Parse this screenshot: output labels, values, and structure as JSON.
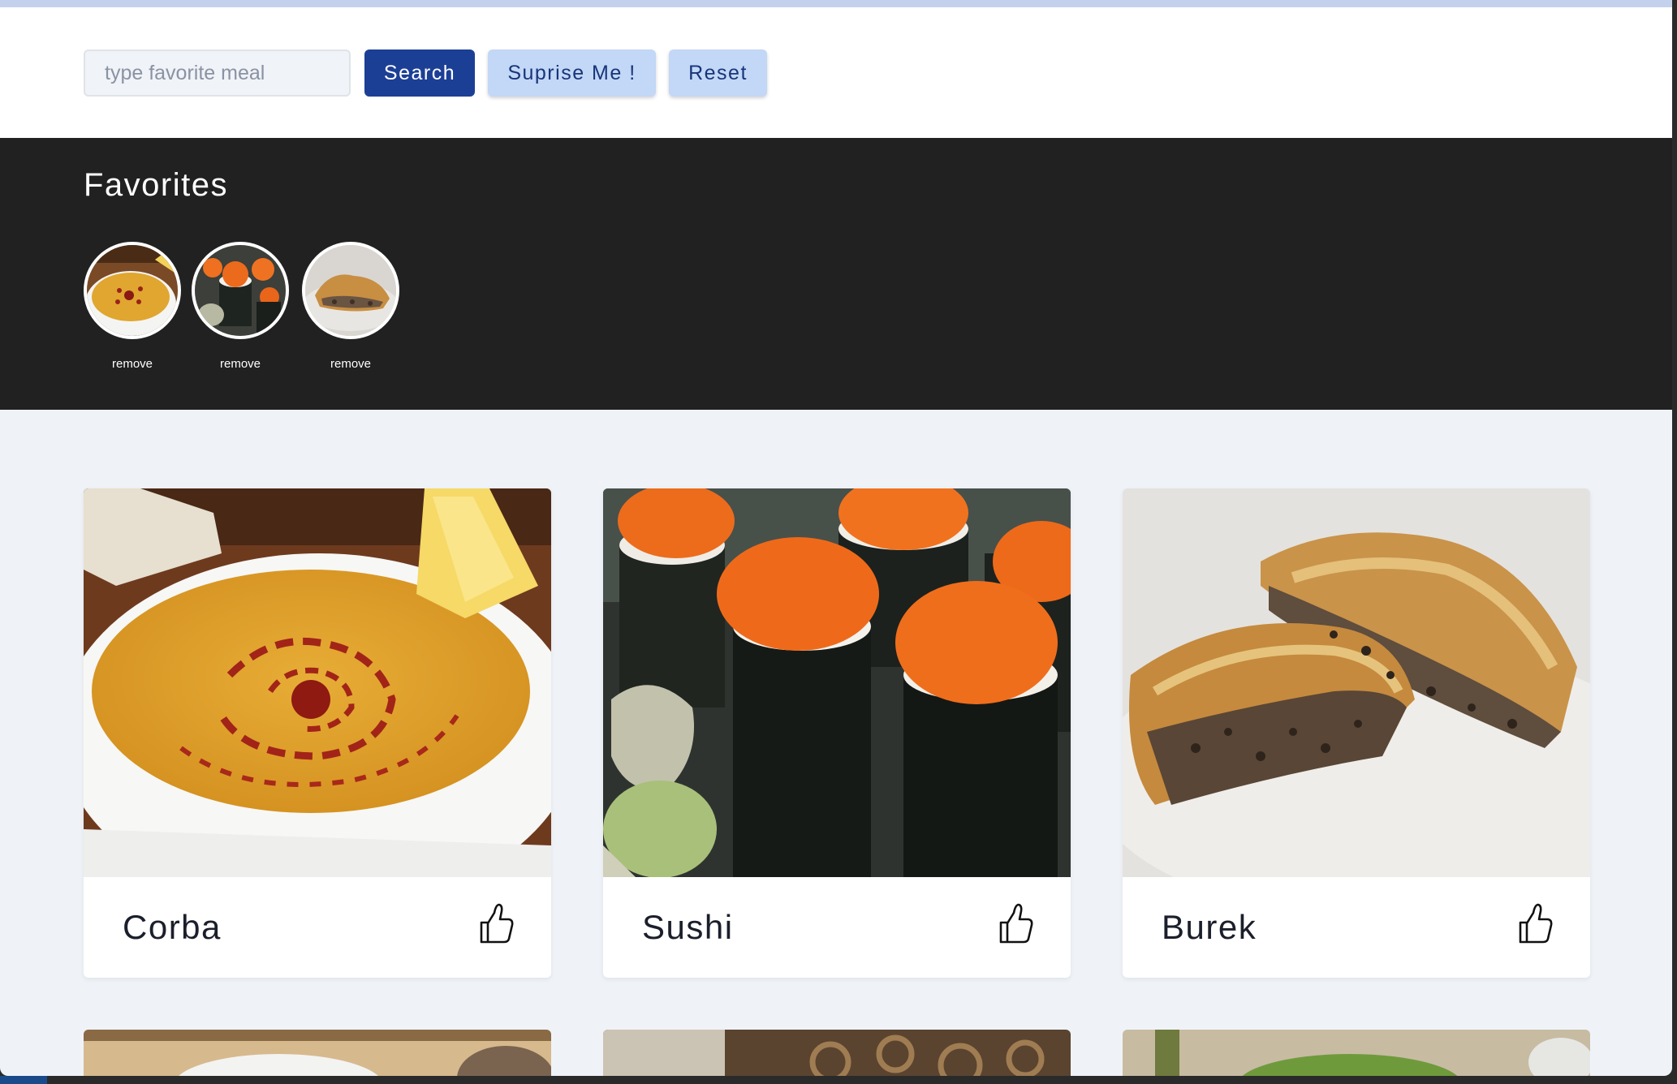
{
  "search": {
    "placeholder": "type favorite meal",
    "value": ""
  },
  "buttons": {
    "search_label": "Search",
    "surprise_label": "Suprise Me !",
    "reset_label": "Reset"
  },
  "favorites": {
    "title": "Favorites",
    "items": [
      {
        "meal": "Corba",
        "remove_label": "remove"
      },
      {
        "meal": "Sushi",
        "remove_label": "remove"
      },
      {
        "meal": "Burek",
        "remove_label": "remove"
      }
    ]
  },
  "meals": [
    {
      "name": "Corba",
      "icon": "thumbs-up-icon"
    },
    {
      "name": "Sushi",
      "icon": "thumbs-up-icon"
    },
    {
      "name": "Burek",
      "icon": "thumbs-up-icon"
    }
  ],
  "colors": {
    "primary": "#1c3f96",
    "secondary": "#c3d7f6",
    "favorites_bg": "#212121",
    "page_bg": "#eff3f8"
  }
}
